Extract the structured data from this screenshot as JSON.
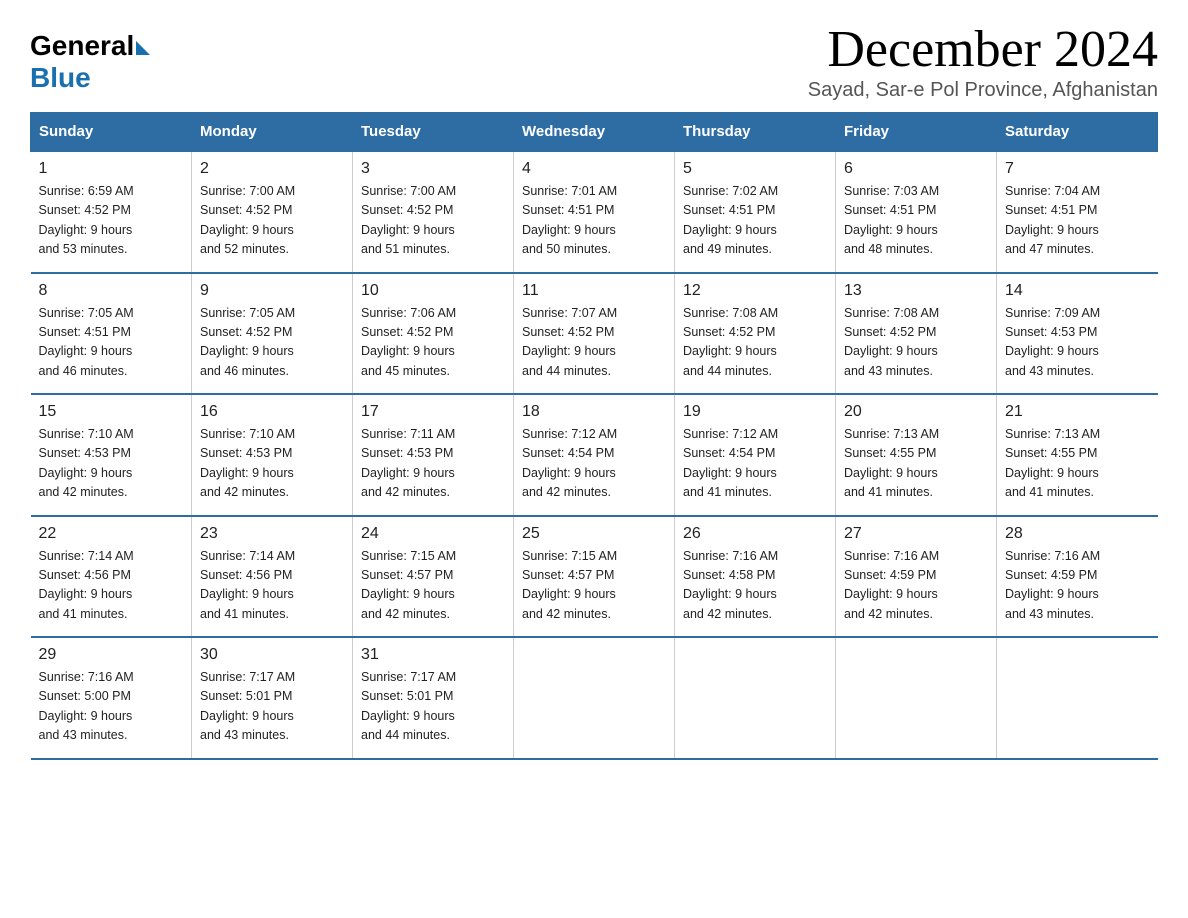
{
  "header": {
    "title": "December 2024",
    "location": "Sayad, Sar-e Pol Province, Afghanistan",
    "logo_general": "General",
    "logo_blue": "Blue"
  },
  "weekdays": [
    "Sunday",
    "Monday",
    "Tuesday",
    "Wednesday",
    "Thursday",
    "Friday",
    "Saturday"
  ],
  "weeks": [
    [
      {
        "day": "1",
        "sunrise": "6:59 AM",
        "sunset": "4:52 PM",
        "daylight": "9 hours and 53 minutes."
      },
      {
        "day": "2",
        "sunrise": "7:00 AM",
        "sunset": "4:52 PM",
        "daylight": "9 hours and 52 minutes."
      },
      {
        "day": "3",
        "sunrise": "7:00 AM",
        "sunset": "4:52 PM",
        "daylight": "9 hours and 51 minutes."
      },
      {
        "day": "4",
        "sunrise": "7:01 AM",
        "sunset": "4:51 PM",
        "daylight": "9 hours and 50 minutes."
      },
      {
        "day": "5",
        "sunrise": "7:02 AM",
        "sunset": "4:51 PM",
        "daylight": "9 hours and 49 minutes."
      },
      {
        "day": "6",
        "sunrise": "7:03 AM",
        "sunset": "4:51 PM",
        "daylight": "9 hours and 48 minutes."
      },
      {
        "day": "7",
        "sunrise": "7:04 AM",
        "sunset": "4:51 PM",
        "daylight": "9 hours and 47 minutes."
      }
    ],
    [
      {
        "day": "8",
        "sunrise": "7:05 AM",
        "sunset": "4:51 PM",
        "daylight": "9 hours and 46 minutes."
      },
      {
        "day": "9",
        "sunrise": "7:05 AM",
        "sunset": "4:52 PM",
        "daylight": "9 hours and 46 minutes."
      },
      {
        "day": "10",
        "sunrise": "7:06 AM",
        "sunset": "4:52 PM",
        "daylight": "9 hours and 45 minutes."
      },
      {
        "day": "11",
        "sunrise": "7:07 AM",
        "sunset": "4:52 PM",
        "daylight": "9 hours and 44 minutes."
      },
      {
        "day": "12",
        "sunrise": "7:08 AM",
        "sunset": "4:52 PM",
        "daylight": "9 hours and 44 minutes."
      },
      {
        "day": "13",
        "sunrise": "7:08 AM",
        "sunset": "4:52 PM",
        "daylight": "9 hours and 43 minutes."
      },
      {
        "day": "14",
        "sunrise": "7:09 AM",
        "sunset": "4:53 PM",
        "daylight": "9 hours and 43 minutes."
      }
    ],
    [
      {
        "day": "15",
        "sunrise": "7:10 AM",
        "sunset": "4:53 PM",
        "daylight": "9 hours and 42 minutes."
      },
      {
        "day": "16",
        "sunrise": "7:10 AM",
        "sunset": "4:53 PM",
        "daylight": "9 hours and 42 minutes."
      },
      {
        "day": "17",
        "sunrise": "7:11 AM",
        "sunset": "4:53 PM",
        "daylight": "9 hours and 42 minutes."
      },
      {
        "day": "18",
        "sunrise": "7:12 AM",
        "sunset": "4:54 PM",
        "daylight": "9 hours and 42 minutes."
      },
      {
        "day": "19",
        "sunrise": "7:12 AM",
        "sunset": "4:54 PM",
        "daylight": "9 hours and 41 minutes."
      },
      {
        "day": "20",
        "sunrise": "7:13 AM",
        "sunset": "4:55 PM",
        "daylight": "9 hours and 41 minutes."
      },
      {
        "day": "21",
        "sunrise": "7:13 AM",
        "sunset": "4:55 PM",
        "daylight": "9 hours and 41 minutes."
      }
    ],
    [
      {
        "day": "22",
        "sunrise": "7:14 AM",
        "sunset": "4:56 PM",
        "daylight": "9 hours and 41 minutes."
      },
      {
        "day": "23",
        "sunrise": "7:14 AM",
        "sunset": "4:56 PM",
        "daylight": "9 hours and 41 minutes."
      },
      {
        "day": "24",
        "sunrise": "7:15 AM",
        "sunset": "4:57 PM",
        "daylight": "9 hours and 42 minutes."
      },
      {
        "day": "25",
        "sunrise": "7:15 AM",
        "sunset": "4:57 PM",
        "daylight": "9 hours and 42 minutes."
      },
      {
        "day": "26",
        "sunrise": "7:16 AM",
        "sunset": "4:58 PM",
        "daylight": "9 hours and 42 minutes."
      },
      {
        "day": "27",
        "sunrise": "7:16 AM",
        "sunset": "4:59 PM",
        "daylight": "9 hours and 42 minutes."
      },
      {
        "day": "28",
        "sunrise": "7:16 AM",
        "sunset": "4:59 PM",
        "daylight": "9 hours and 43 minutes."
      }
    ],
    [
      {
        "day": "29",
        "sunrise": "7:16 AM",
        "sunset": "5:00 PM",
        "daylight": "9 hours and 43 minutes."
      },
      {
        "day": "30",
        "sunrise": "7:17 AM",
        "sunset": "5:01 PM",
        "daylight": "9 hours and 43 minutes."
      },
      {
        "day": "31",
        "sunrise": "7:17 AM",
        "sunset": "5:01 PM",
        "daylight": "9 hours and 44 minutes."
      },
      null,
      null,
      null,
      null
    ]
  ]
}
